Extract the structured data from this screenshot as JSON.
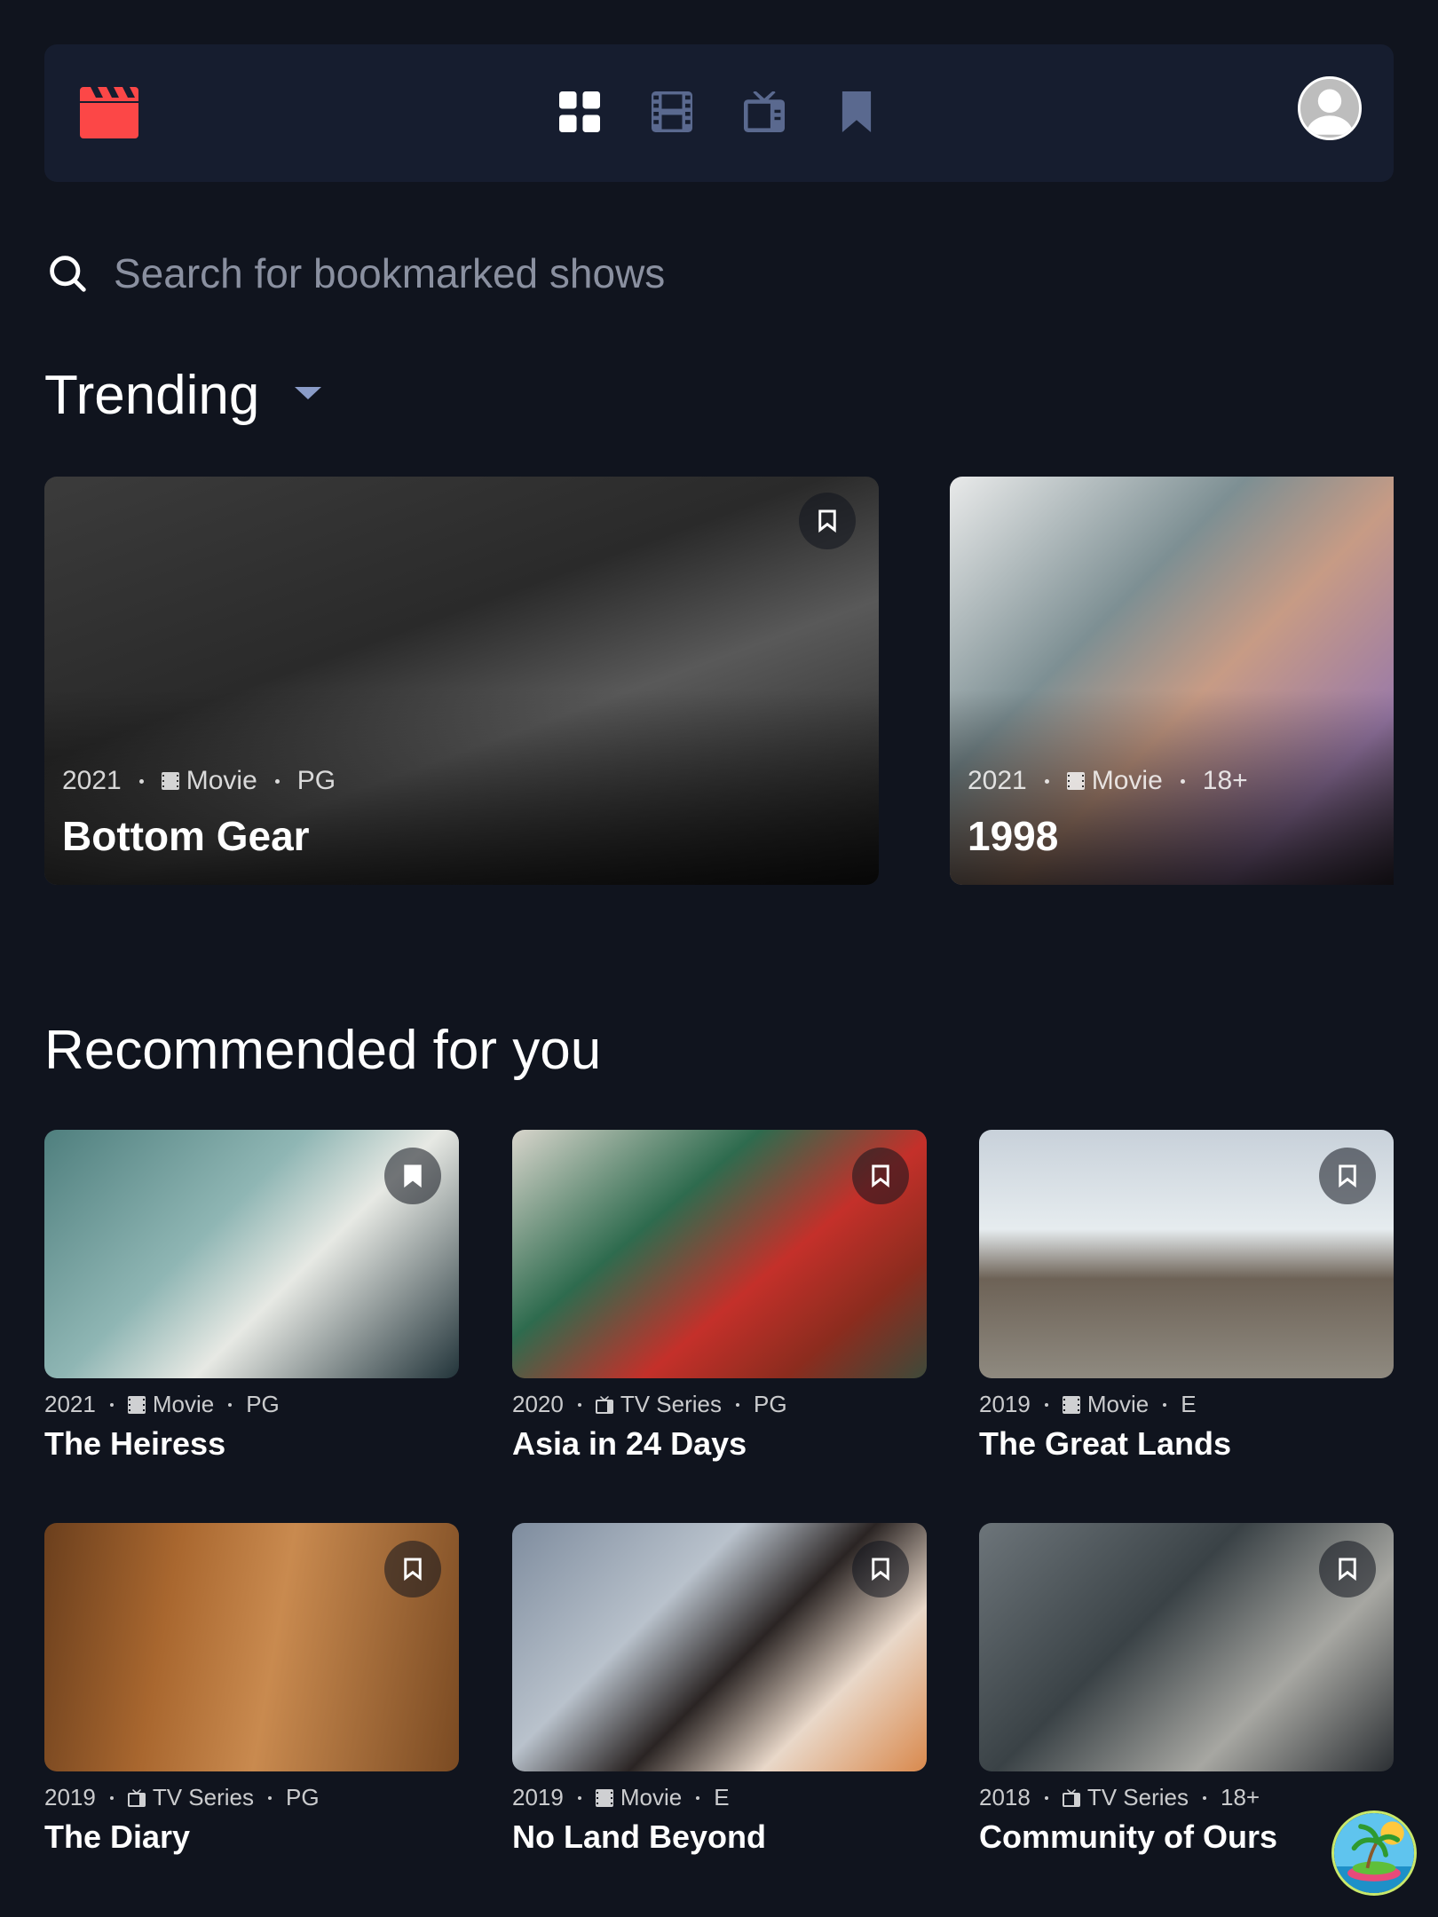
{
  "colors": {
    "background": "#10141e",
    "surface": "#161d2f",
    "accent": "#fc4747",
    "nav_inactive": "#5a698f",
    "nav_active": "#ffffff"
  },
  "nav": {
    "logo_icon": "clapperboard-icon",
    "items": [
      {
        "icon": "grid-icon",
        "active": true
      },
      {
        "icon": "film-icon",
        "active": false
      },
      {
        "icon": "tv-icon",
        "active": false
      },
      {
        "icon": "bookmark-icon",
        "active": false
      }
    ],
    "avatar_icon": "user-avatar"
  },
  "search": {
    "placeholder": "Search for bookmarked shows",
    "value": ""
  },
  "trending": {
    "heading": "Trending",
    "items": [
      {
        "year": "2021",
        "category": "Movie",
        "rating": "PG",
        "title": "Bottom Gear",
        "bookmarked": false
      },
      {
        "year": "2021",
        "category": "Movie",
        "rating": "18+",
        "title": "1998",
        "bookmarked": false
      }
    ]
  },
  "recommended": {
    "heading": "Recommended for you",
    "items": [
      {
        "year": "2021",
        "category": "Movie",
        "rating": "PG",
        "title": "The Heiress",
        "bookmarked": true
      },
      {
        "year": "2020",
        "category": "TV Series",
        "rating": "PG",
        "title": "Asia in 24 Days",
        "bookmarked": false
      },
      {
        "year": "2019",
        "category": "Movie",
        "rating": "E",
        "title": "The Great Lands",
        "bookmarked": false
      },
      {
        "year": "2019",
        "category": "TV Series",
        "rating": "PG",
        "title": "The Diary",
        "bookmarked": false
      },
      {
        "year": "2019",
        "category": "Movie",
        "rating": "E",
        "title": "No Land Beyond",
        "bookmarked": false
      },
      {
        "year": "2018",
        "category": "TV Series",
        "rating": "18+",
        "title": "Community of Ours",
        "bookmarked": false
      }
    ]
  }
}
